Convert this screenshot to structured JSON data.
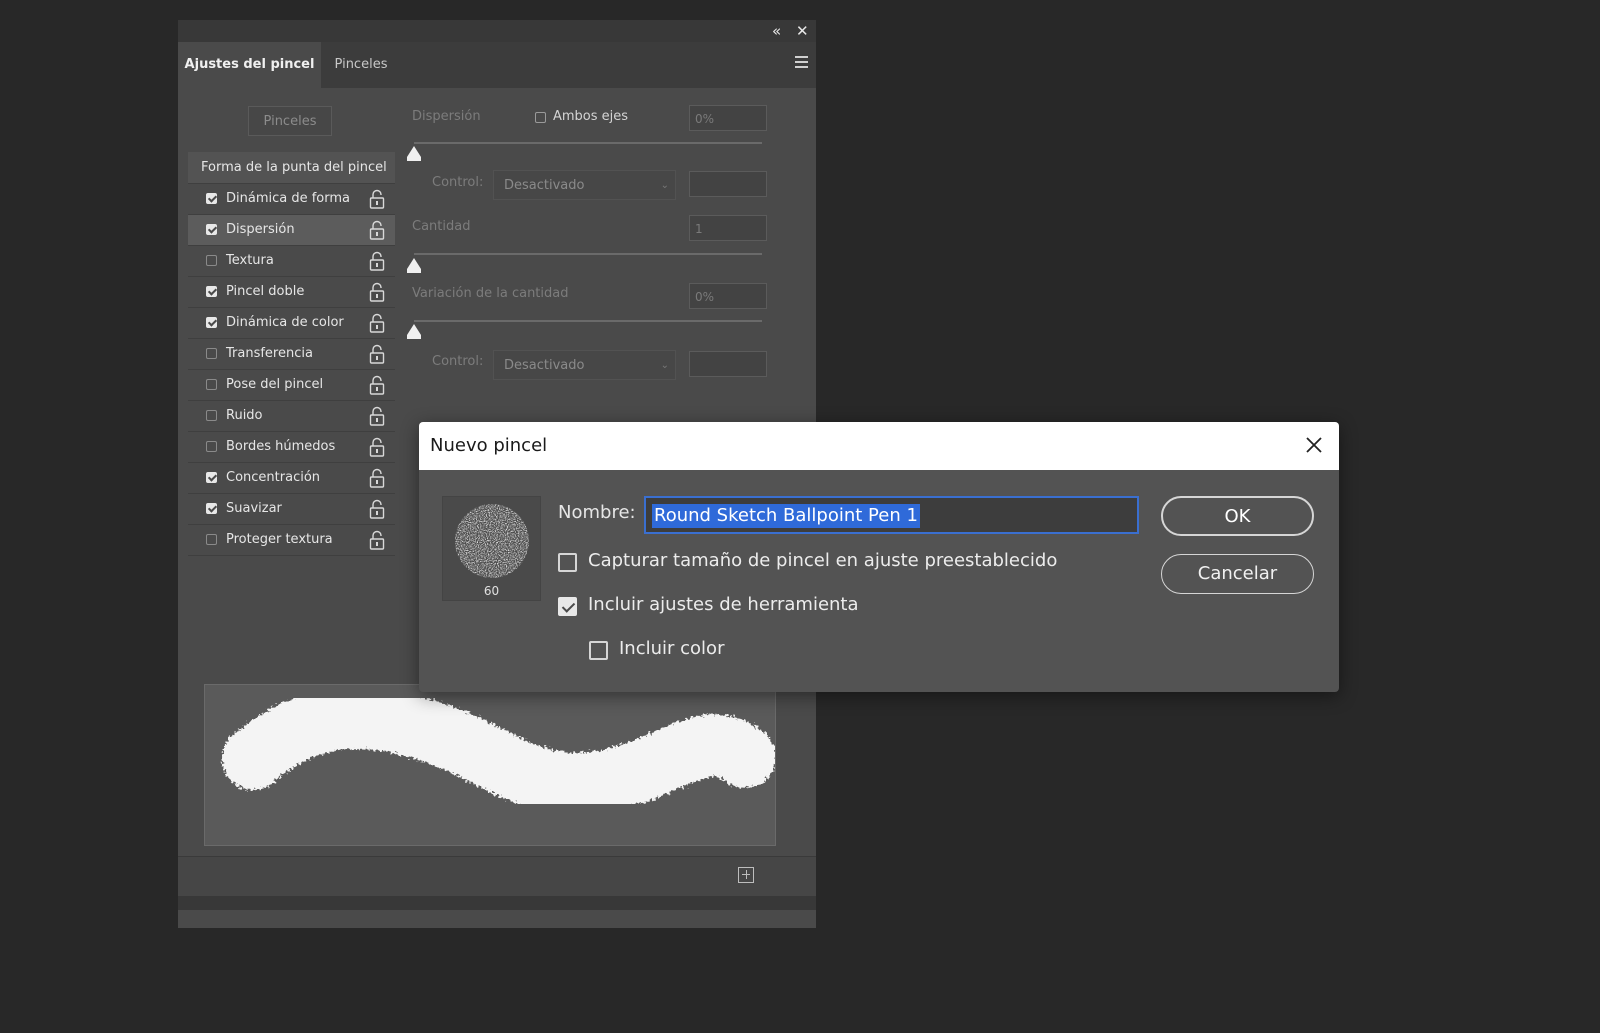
{
  "panel": {
    "collapse_glyph": "«",
    "close_glyph": "✕",
    "tabs": [
      {
        "label": "Ajustes del pincel"
      },
      {
        "label": "Pinceles"
      }
    ],
    "brushes_button": "Pinceles",
    "list_header": "Forma de la punta del pincel",
    "items": [
      {
        "label": "Dinámica de forma",
        "checked": true
      },
      {
        "label": "Dispersión",
        "checked": true,
        "selected": true
      },
      {
        "label": "Textura",
        "checked": false
      },
      {
        "label": "Pincel doble",
        "checked": true
      },
      {
        "label": "Dinámica de color",
        "checked": true
      },
      {
        "label": "Transferencia",
        "checked": false
      },
      {
        "label": "Pose del pincel",
        "checked": false
      },
      {
        "label": "Ruido",
        "checked": false
      },
      {
        "label": "Bordes húmedos",
        "checked": false
      },
      {
        "label": "Concentración",
        "checked": true
      },
      {
        "label": "Suavizar",
        "checked": true
      },
      {
        "label": "Proteger textura",
        "checked": false
      }
    ],
    "controls": {
      "scatter_label": "Dispersión",
      "both_axes_label": "Ambos ejes",
      "both_axes_checked": false,
      "scatter_value": "0%",
      "control_label": "Control:",
      "control_value": "Desactivado",
      "count_label": "Cantidad",
      "count_value": "1",
      "count_jitter_label": "Variación de la cantidad",
      "count_jitter_value": "0%",
      "control2_label": "Control:",
      "control2_value": "Desactivado"
    }
  },
  "dialog": {
    "title": "Nuevo pincel",
    "brush_size": "60",
    "name_label": "Nombre:",
    "name_value": "Round Sketch Ballpoint Pen 1",
    "capture_size_label": "Capturar tamaño de pincel en ajuste preestablecido",
    "capture_size_checked": false,
    "include_tool_label": "Incluir ajustes de herramienta",
    "include_tool_checked": true,
    "include_color_label": "Incluir color",
    "include_color_checked": false,
    "ok_label": "OK",
    "cancel_label": "Cancelar"
  },
  "icons": {
    "lock": "lock-icon",
    "close": "close-icon",
    "collapse": "double-chevron-left-icon",
    "menu": "hamburger-menu-icon",
    "new_brush": "new-brush-icon"
  },
  "colors": {
    "selection_highlight": "#2f6ad9",
    "panel_bg": "#4a4a4a",
    "dialog_bg": "#535353",
    "app_bg": "#282828"
  }
}
